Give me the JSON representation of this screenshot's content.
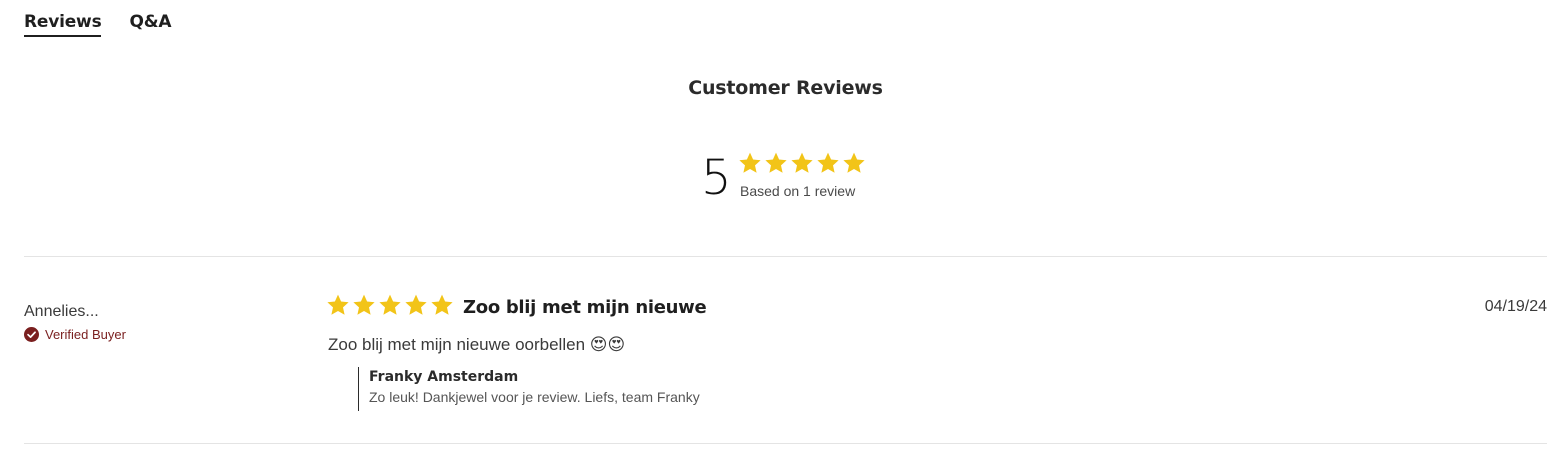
{
  "tabs": [
    {
      "label": "Reviews",
      "active": true
    },
    {
      "label": "Q&A",
      "active": false
    }
  ],
  "summary": {
    "title": "Customer Reviews",
    "average_rating": "5",
    "stars": 5,
    "caption": "Based on 1 review"
  },
  "review": {
    "author": "Annelies...",
    "badge": "Verified Buyer",
    "rating": 5,
    "title": "Zoo blij met mijn nieuwe",
    "date": "04/19/24",
    "body": "Zoo blij met mijn nieuwe oorbellen 😍😍",
    "reply": {
      "author": "Franky Amsterdam",
      "text": "Zo leuk! Dankjewel voor je review. Liefs, team Franky"
    }
  },
  "colors": {
    "star": "#F2C418",
    "verified": "#7A1F1F",
    "divider": "#E4E4E4"
  },
  "icons": {
    "star": "star-icon",
    "verified": "check-circle-icon"
  }
}
